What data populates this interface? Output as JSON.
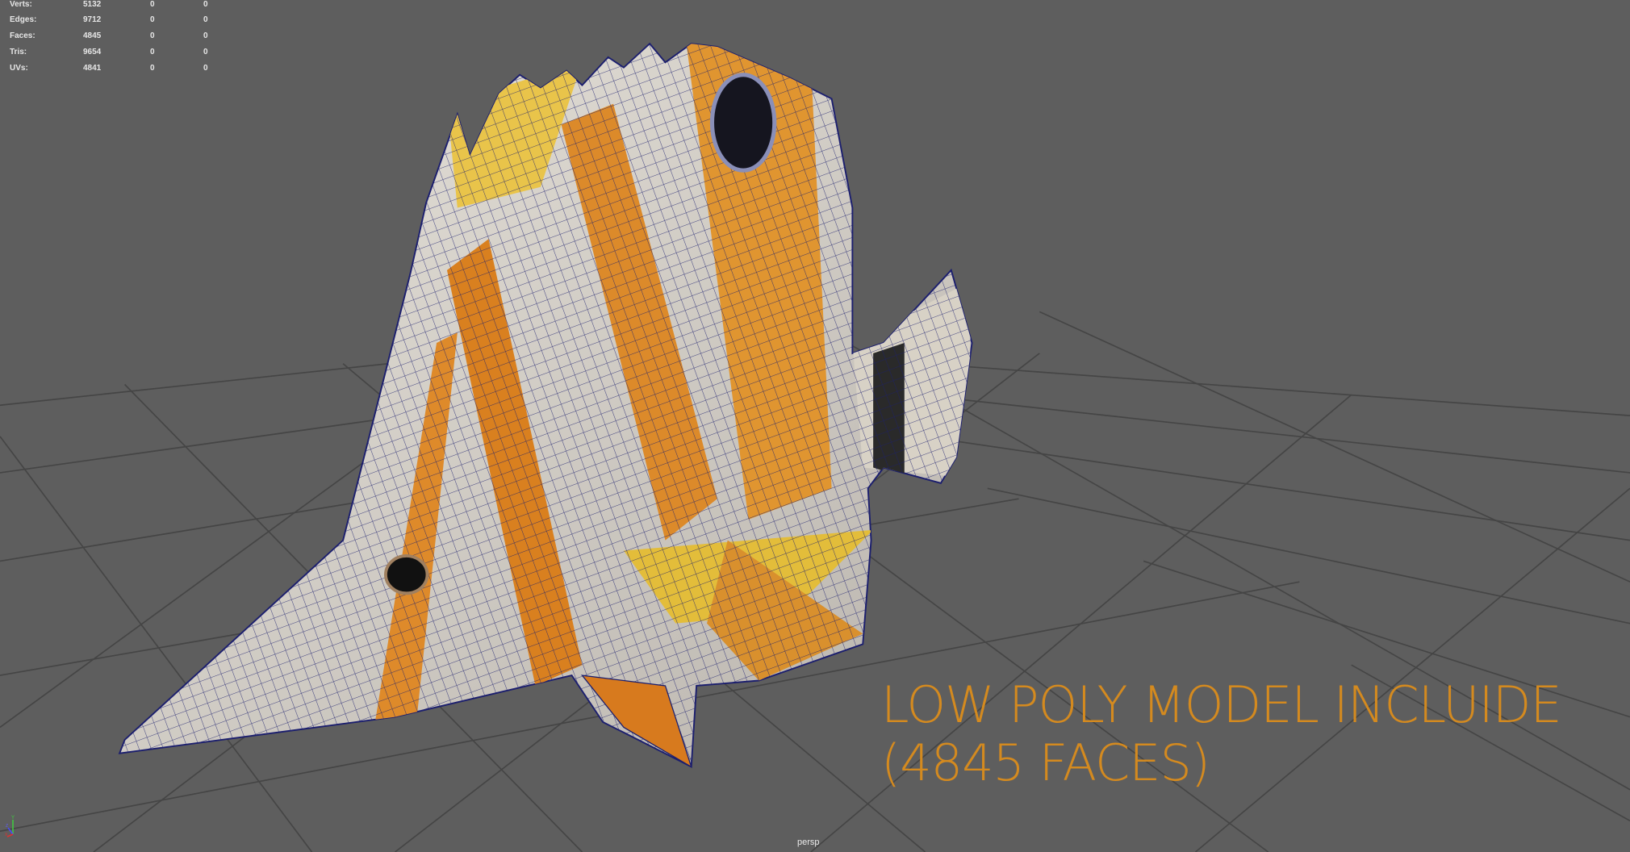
{
  "hud": {
    "rows": [
      {
        "label": "Verts:",
        "value": "5132",
        "sel": "0",
        "comp": "0"
      },
      {
        "label": "Edges:",
        "value": "9712",
        "sel": "0",
        "comp": "0"
      },
      {
        "label": "Faces:",
        "value": "4845",
        "sel": "0",
        "comp": "0"
      },
      {
        "label": "Tris:",
        "value": "9654",
        "sel": "0",
        "comp": "0"
      },
      {
        "label": "UVs:",
        "value": "4841",
        "sel": "0",
        "comp": "0"
      }
    ]
  },
  "overlay": {
    "line1": "LOW POLY MODEL INCLUIDE",
    "line2": "(4845 FACES)",
    "color": "#d48a1f"
  },
  "camera": {
    "label": "persp"
  },
  "axis": {
    "y": "Y",
    "z": "Z",
    "x": "X"
  }
}
